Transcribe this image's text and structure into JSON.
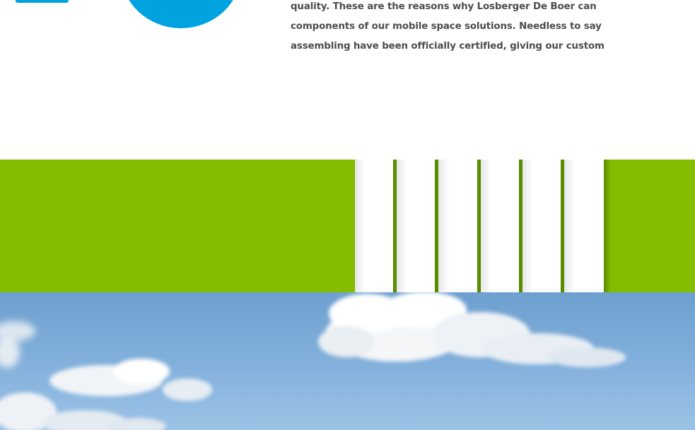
{
  "body_text": {
    "lines": [
      "quality. These are the reasons why Losberger De Boer can",
      "components of our mobile space solutions. Needless to say",
      "assembling have been officially certified, giving our custom"
    ]
  },
  "colors": {
    "brand_blue": "#00a3e0",
    "brand_green": "#84bd00",
    "stripe_green": "#5a8c00",
    "text_gray": "#4d4d4d",
    "sky_blue": "#84b1dc"
  },
  "images": {
    "sky": "blue-sky-with-clouds-photo"
  }
}
